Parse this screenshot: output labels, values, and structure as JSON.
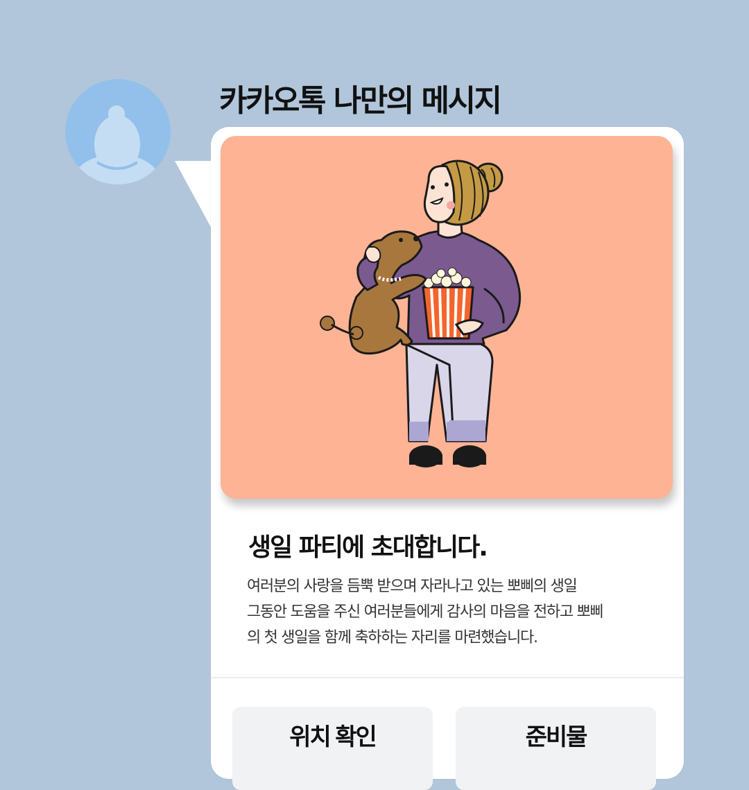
{
  "chat": {
    "sender_name": "카카오톡 나만의 메시지",
    "avatar_icon": "default-profile-icon"
  },
  "card": {
    "image_icon": "woman-with-dog-and-popcorn-illustration",
    "title": "생일 파티에 초대합니다.",
    "description_lines": [
      "여러분의 사랑을 듬뿍 받으며 자라나고 있는 뽀삐의 생일",
      "그동안 도움을 주신 여러분들에게 감사의 마음을 전하고 뽀삐",
      "의 첫 생일을 함께 축하하는 자리를 마련했습니다."
    ],
    "buttons": [
      {
        "label": "위치 확인"
      },
      {
        "label": "준비물"
      }
    ]
  },
  "colors": {
    "background": "#b1c6da",
    "avatar": "#93c0ea",
    "bubble": "#ffffff",
    "hero_background": "#fdb394",
    "button_background": "#f1f2f4"
  }
}
